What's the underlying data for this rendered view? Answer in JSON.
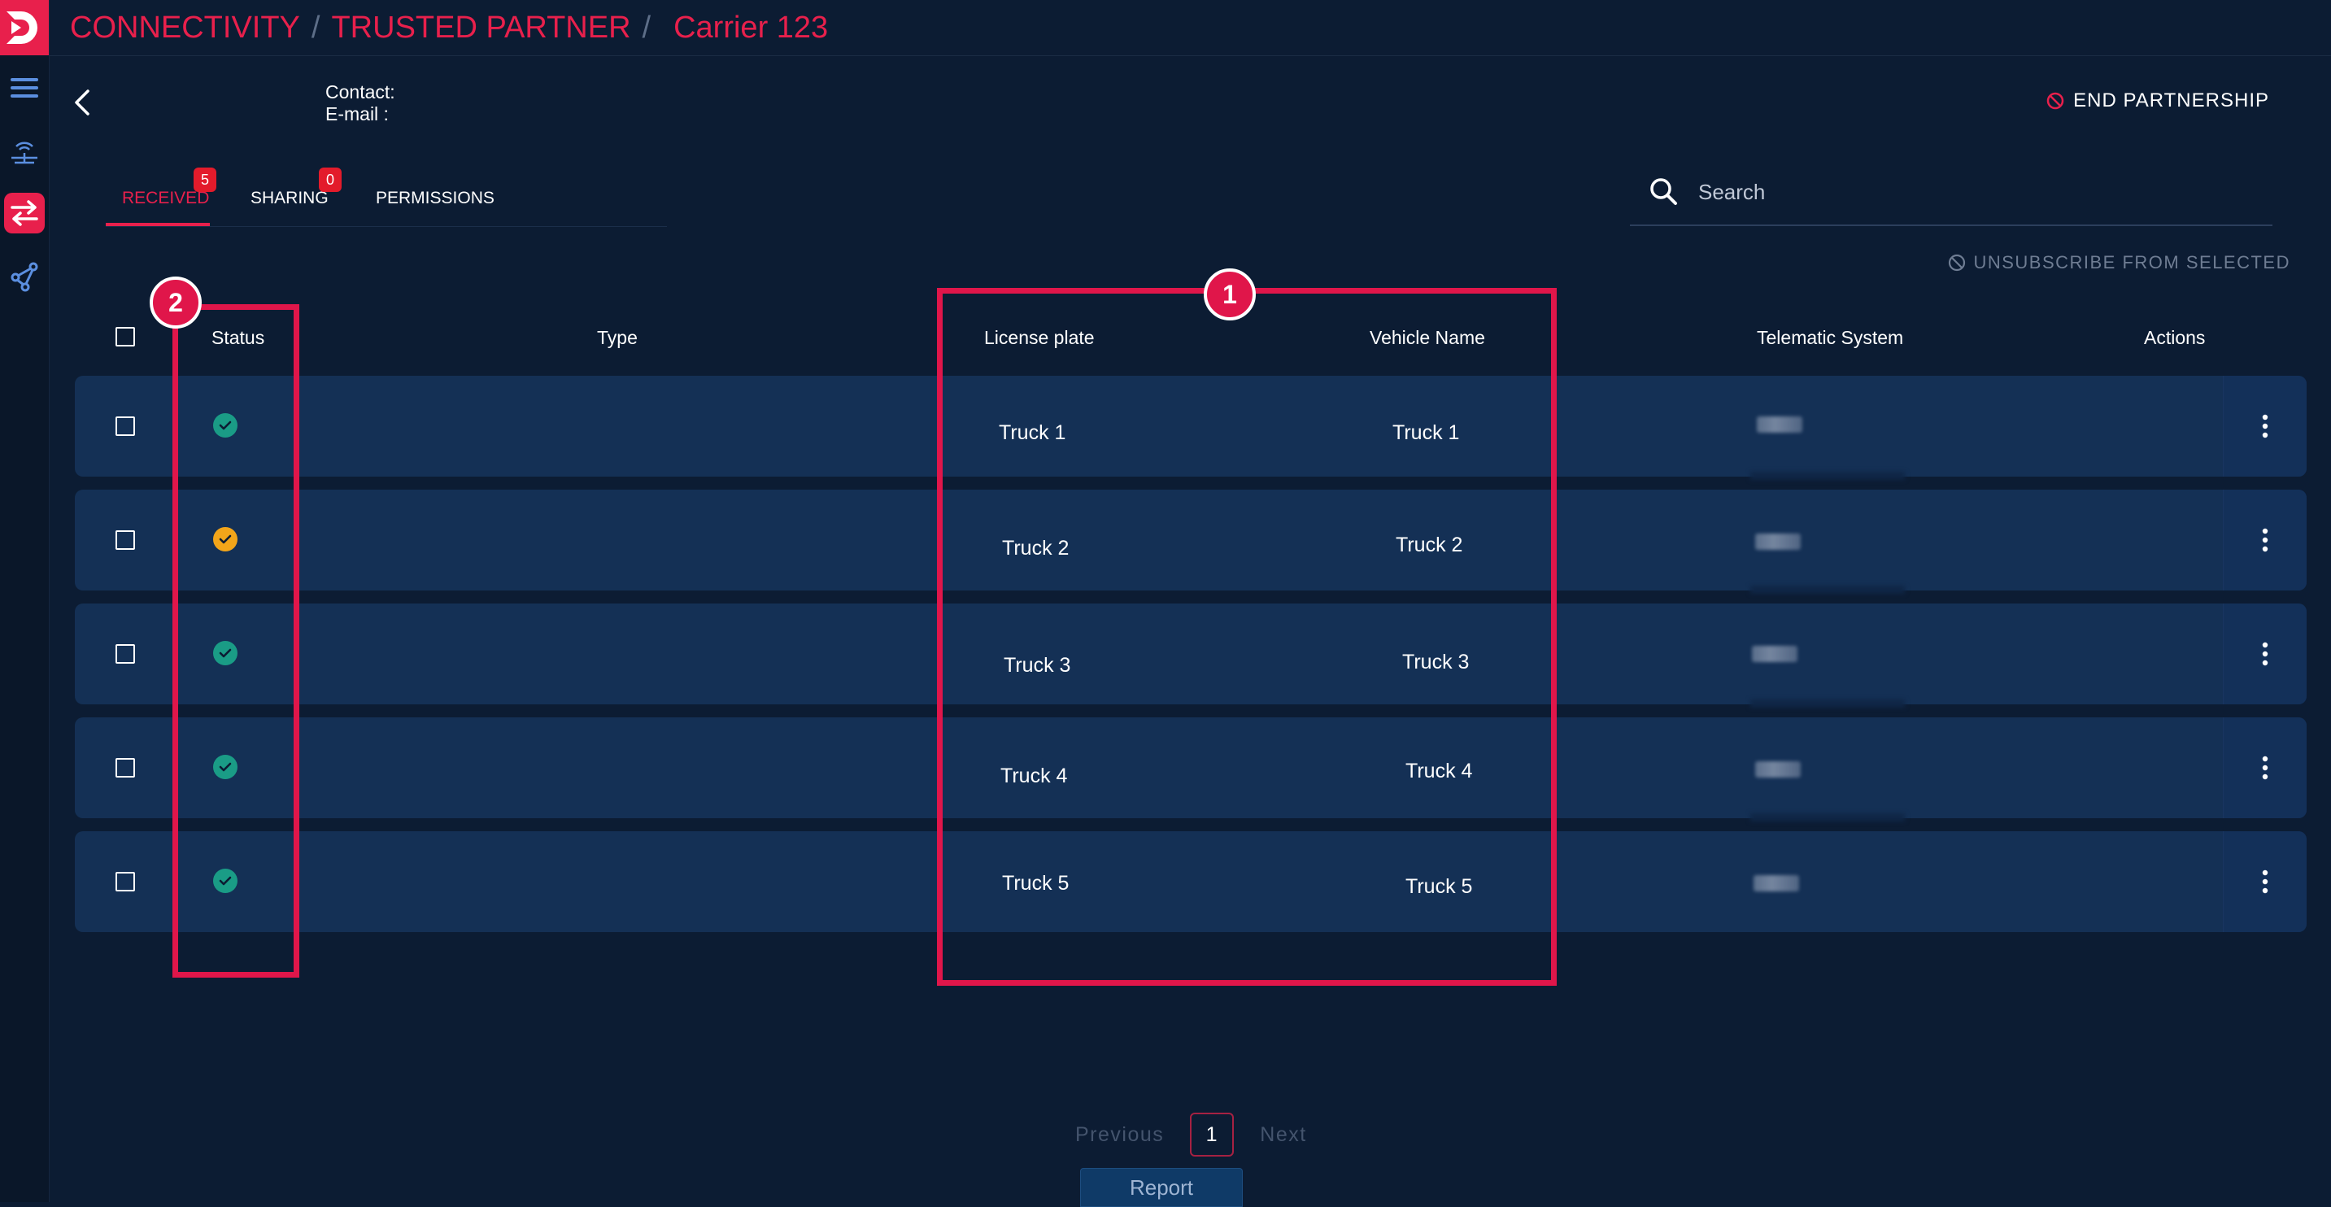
{
  "header": {
    "breadcrumbs": [
      "CONNECTIVITY",
      "TRUSTED PARTNER",
      "Carrier 123"
    ]
  },
  "partner": {
    "contact_label": "Contact:",
    "email_label": "E-mail :",
    "end_partnership_label": "END PARTNERSHIP"
  },
  "tabs": [
    {
      "label": "RECEIVED",
      "badge": "5",
      "active": true
    },
    {
      "label": "SHARING",
      "badge": "0",
      "active": false
    },
    {
      "label": "PERMISSIONS",
      "badge": "",
      "active": false
    }
  ],
  "search": {
    "placeholder": "Search",
    "value": ""
  },
  "unsubscribe_label": "UNSUBSCRIBE FROM SELECTED",
  "table": {
    "columns": [
      "Status",
      "Type",
      "License plate",
      "Vehicle Name",
      "Telematic System",
      "Actions"
    ],
    "rows": [
      {
        "status": "active",
        "license_plate": "Truck 1",
        "vehicle_name": "Truck 1"
      },
      {
        "status": "pending",
        "license_plate": "Truck 2",
        "vehicle_name": "Truck 2"
      },
      {
        "status": "active",
        "license_plate": "Truck 3",
        "vehicle_name": "Truck 3"
      },
      {
        "status": "active",
        "license_plate": "Truck 4",
        "vehicle_name": "Truck 4"
      },
      {
        "status": "active",
        "license_plate": "Truck 5",
        "vehicle_name": "Truck 5"
      }
    ]
  },
  "status_colors": {
    "active": "#1a9c86",
    "pending": "#f2a51a"
  },
  "annotations": [
    "1",
    "2"
  ],
  "pagination": {
    "previous": "Previous",
    "current": "1",
    "next": "Next"
  },
  "report_label": "Report",
  "icons": {
    "sidebar": [
      "menu-icon",
      "antenna-icon",
      "swap-arrows-icon",
      "network-share-icon"
    ],
    "row_action": "more-vertical-icon"
  },
  "colors": {
    "accent": "#e8204c",
    "background": "#0c1c33",
    "row": "#143055"
  }
}
